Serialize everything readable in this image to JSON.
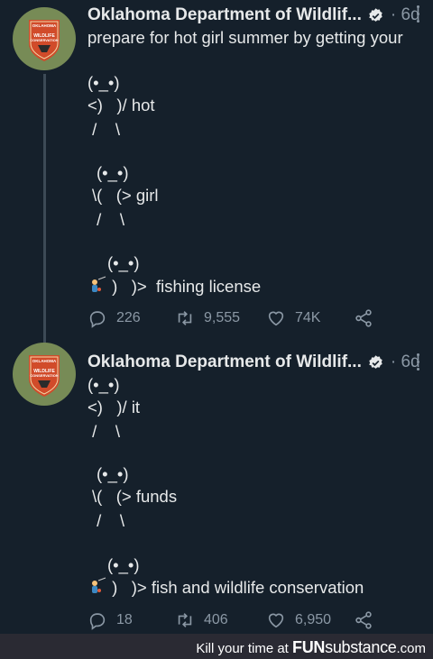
{
  "tweets": [
    {
      "name": "Oklahoma Department of Wildlif...",
      "time": "· 6d",
      "lines": [
        "prepare for hot girl summer by getting your",
        "(•_•)",
        "<)   )/ hot",
        " /    \\",
        "(•_•)",
        "\\(   (> girl",
        " /    \\",
        "(•_•)",
        ")   )>  fishing license"
      ],
      "replies": "226",
      "retweets": "9,555",
      "likes": "74K"
    },
    {
      "name": "Oklahoma Department of Wildlif...",
      "time": "· 6d",
      "lines": [
        "(•_•)",
        "<)   )/ it",
        " /    \\",
        "(•_•)",
        "\\(   (> funds",
        " /    \\",
        "(•_•)",
        ")   )> fish and wildlife conservation"
      ],
      "replies": "18",
      "retweets": "406",
      "likes": "6,950"
    }
  ],
  "avatar": {
    "badge_lines": [
      "OKLAHOMA",
      "WILDLIFE",
      "CONSERVATION"
    ],
    "badge_color": "#d14b2a",
    "background": "#778b56"
  },
  "footer": {
    "prefix": "Kill your time at",
    "brand_fun": "FUN",
    "brand_sub": "substance",
    "brand_com": ".com"
  },
  "colors": {
    "background": "#15202b",
    "text": "#e7e9ea",
    "muted": "#8b98a5",
    "verified": "#e7e9ea",
    "thread_line": "#3d4a56"
  },
  "icons": [
    "verified-badge-icon",
    "more-icon",
    "reply-icon",
    "retweet-icon",
    "like-icon",
    "share-icon",
    "fisherman-emoji-icon"
  ]
}
